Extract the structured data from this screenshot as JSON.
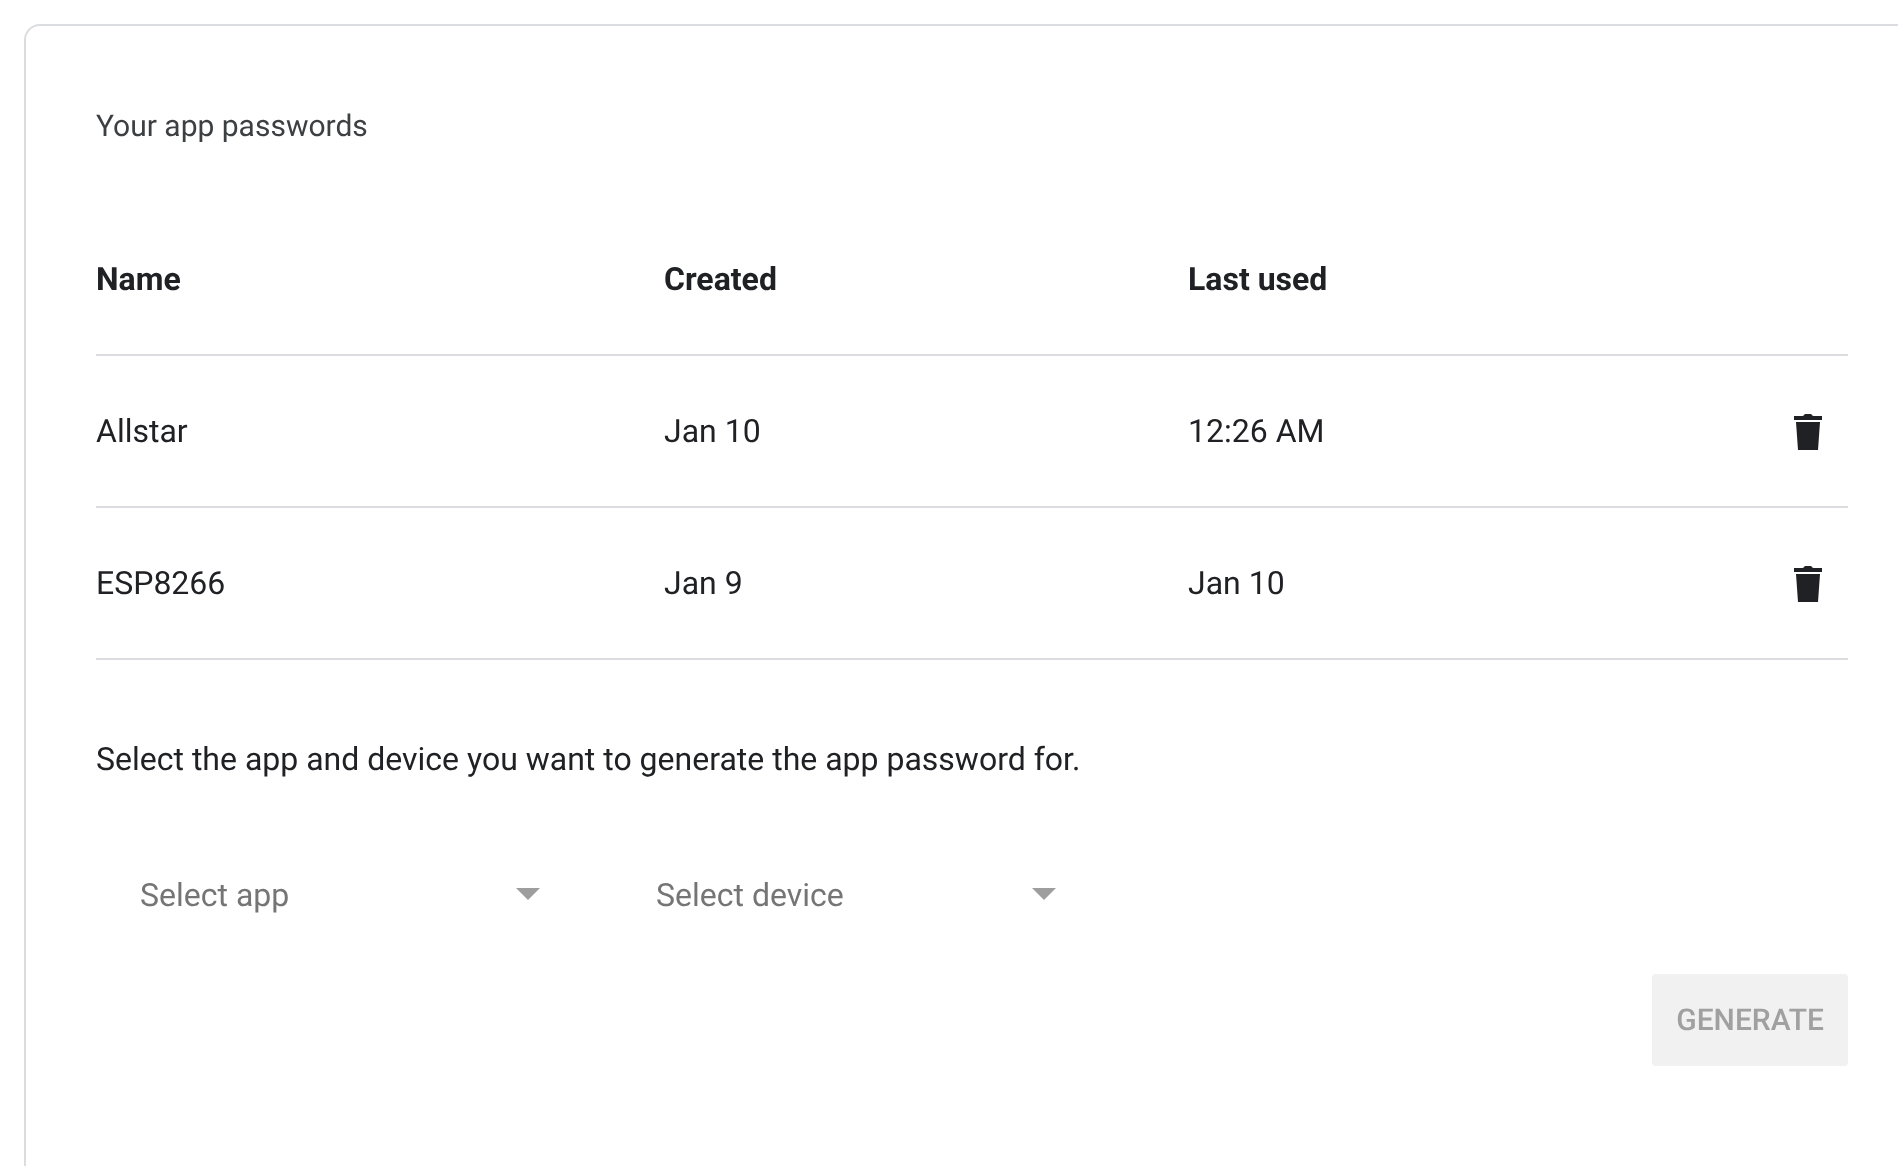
{
  "section_title": "Your app passwords",
  "table": {
    "columns": [
      "Name",
      "Created",
      "Last used"
    ],
    "rows": [
      {
        "name": "Allstar",
        "created": "Jan 10",
        "last_used": "12:26 AM"
      },
      {
        "name": "ESP8266",
        "created": "Jan 9",
        "last_used": "Jan 10"
      }
    ]
  },
  "instructions": "Select the app and device you want to generate the app password for.",
  "selects": [
    {
      "placeholder": "Select app"
    },
    {
      "placeholder": "Select device"
    }
  ],
  "generate_button": {
    "label": "GENERATE",
    "disabled": true
  }
}
